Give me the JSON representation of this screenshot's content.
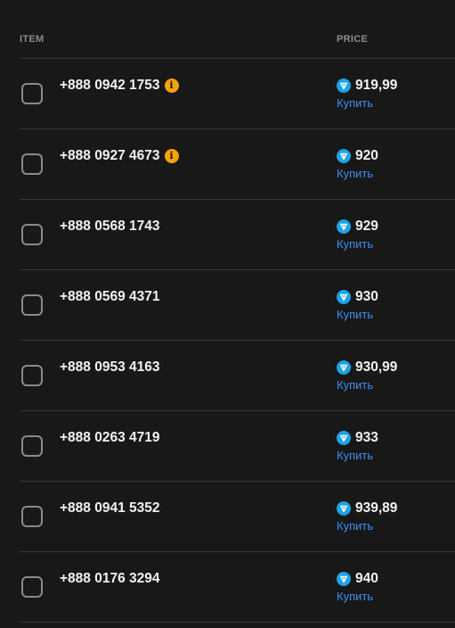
{
  "header": {
    "item_label": "ITEM",
    "price_label": "PRICE"
  },
  "buy_label": "Купить",
  "colors": {
    "background": "#181818",
    "accent": "#3d8ef0",
    "warning": "#f5a20a",
    "ton": "#1ea3e6"
  },
  "rows": [
    {
      "number": "+888 0942 1753",
      "info": true,
      "price": "919,99"
    },
    {
      "number": "+888 0927 4673",
      "info": true,
      "price": "920"
    },
    {
      "number": "+888 0568 1743",
      "info": false,
      "price": "929"
    },
    {
      "number": "+888 0569 4371",
      "info": false,
      "price": "930"
    },
    {
      "number": "+888 0953 4163",
      "info": false,
      "price": "930,99"
    },
    {
      "number": "+888 0263 4719",
      "info": false,
      "price": "933"
    },
    {
      "number": "+888 0941 5352",
      "info": false,
      "price": "939,89"
    },
    {
      "number": "+888 0176 3294",
      "info": false,
      "price": "940"
    }
  ]
}
